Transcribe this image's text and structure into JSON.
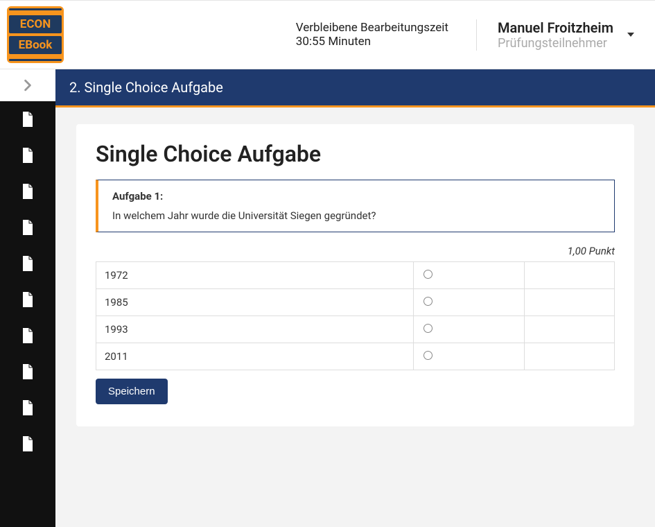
{
  "logo": {
    "line1": "ECON",
    "line2": "EBook"
  },
  "timer": {
    "label": "Verbleibene Bearbeitungszeit",
    "value": "30:55 Minuten"
  },
  "user": {
    "name": "Manuel Froitzheim",
    "role": "Prüfungsteilnehmer"
  },
  "sidebar": {
    "items": [
      {
        "id": 1
      },
      {
        "id": 2
      },
      {
        "id": 3
      },
      {
        "id": 4
      },
      {
        "id": 5
      },
      {
        "id": 6
      },
      {
        "id": 7
      },
      {
        "id": 8
      },
      {
        "id": 9
      },
      {
        "id": 10
      }
    ]
  },
  "page": {
    "header": "2. Single Choice Aufgabe"
  },
  "task": {
    "title": "Single Choice Aufgabe",
    "number_label": "Aufgabe 1:",
    "question": "In welchem Jahr wurde die Universität Siegen gegründet?",
    "points": "1,00 Punkt",
    "choices": [
      "1972",
      "1985",
      "1993",
      "2011"
    ],
    "save_label": "Speichern"
  }
}
